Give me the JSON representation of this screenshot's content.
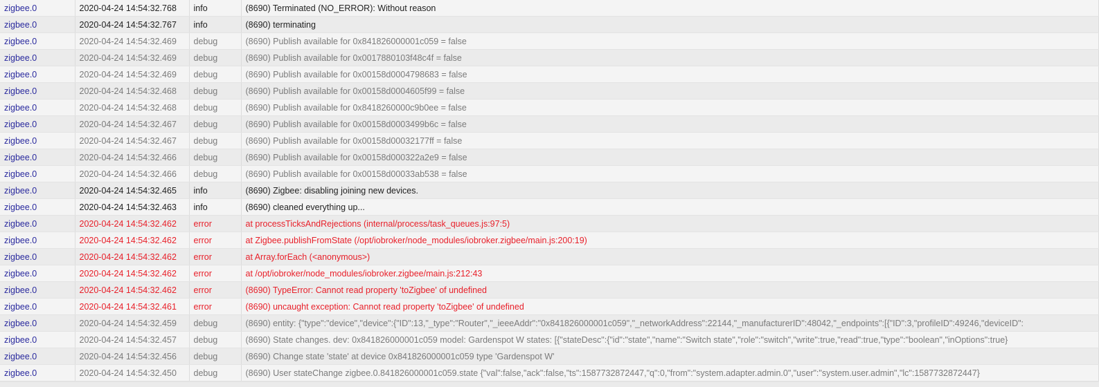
{
  "log": {
    "rows": [
      {
        "source": "zigbee.0",
        "time": "2020-04-24 14:54:32.768",
        "severity": "info",
        "message": "(8690) Terminated (NO_ERROR): Without reason"
      },
      {
        "source": "zigbee.0",
        "time": "2020-04-24 14:54:32.767",
        "severity": "info",
        "message": "(8690) terminating"
      },
      {
        "source": "zigbee.0",
        "time": "2020-04-24 14:54:32.469",
        "severity": "debug",
        "message": "(8690) Publish available for 0x841826000001c059 = false"
      },
      {
        "source": "zigbee.0",
        "time": "2020-04-24 14:54:32.469",
        "severity": "debug",
        "message": "(8690) Publish available for 0x0017880103f48c4f = false"
      },
      {
        "source": "zigbee.0",
        "time": "2020-04-24 14:54:32.469",
        "severity": "debug",
        "message": "(8690) Publish available for 0x00158d0004798683 = false"
      },
      {
        "source": "zigbee.0",
        "time": "2020-04-24 14:54:32.468",
        "severity": "debug",
        "message": "(8690) Publish available for 0x00158d0004605f99 = false"
      },
      {
        "source": "zigbee.0",
        "time": "2020-04-24 14:54:32.468",
        "severity": "debug",
        "message": "(8690) Publish available for 0x8418260000c9b0ee = false"
      },
      {
        "source": "zigbee.0",
        "time": "2020-04-24 14:54:32.467",
        "severity": "debug",
        "message": "(8690) Publish available for 0x00158d0003499b6c = false"
      },
      {
        "source": "zigbee.0",
        "time": "2020-04-24 14:54:32.467",
        "severity": "debug",
        "message": "(8690) Publish available for 0x00158d00032177ff = false"
      },
      {
        "source": "zigbee.0",
        "time": "2020-04-24 14:54:32.466",
        "severity": "debug",
        "message": "(8690) Publish available for 0x00158d000322a2e9 = false"
      },
      {
        "source": "zigbee.0",
        "time": "2020-04-24 14:54:32.466",
        "severity": "debug",
        "message": "(8690) Publish available for 0x00158d00033ab538 = false"
      },
      {
        "source": "zigbee.0",
        "time": "2020-04-24 14:54:32.465",
        "severity": "info",
        "message": "(8690) Zigbee: disabling joining new devices."
      },
      {
        "source": "zigbee.0",
        "time": "2020-04-24 14:54:32.463",
        "severity": "info",
        "message": "(8690) cleaned everything up..."
      },
      {
        "source": "zigbee.0",
        "time": "2020-04-24 14:54:32.462",
        "severity": "error",
        "message": "at processTicksAndRejections (internal/process/task_queues.js:97:5)"
      },
      {
        "source": "zigbee.0",
        "time": "2020-04-24 14:54:32.462",
        "severity": "error",
        "message": "at Zigbee.publishFromState (/opt/iobroker/node_modules/iobroker.zigbee/main.js:200:19)"
      },
      {
        "source": "zigbee.0",
        "time": "2020-04-24 14:54:32.462",
        "severity": "error",
        "message": "at Array.forEach (<anonymous>)"
      },
      {
        "source": "zigbee.0",
        "time": "2020-04-24 14:54:32.462",
        "severity": "error",
        "message": "at /opt/iobroker/node_modules/iobroker.zigbee/main.js:212:43"
      },
      {
        "source": "zigbee.0",
        "time": "2020-04-24 14:54:32.462",
        "severity": "error",
        "message": "(8690) TypeError: Cannot read property 'toZigbee' of undefined"
      },
      {
        "source": "zigbee.0",
        "time": "2020-04-24 14:54:32.461",
        "severity": "error",
        "message": "(8690) uncaught exception: Cannot read property 'toZigbee' of undefined"
      },
      {
        "source": "zigbee.0",
        "time": "2020-04-24 14:54:32.459",
        "severity": "debug",
        "message": "(8690) entity: {\"type\":\"device\",\"device\":{\"ID\":13,\"_type\":\"Router\",\"_ieeeAddr\":\"0x841826000001c059\",\"_networkAddress\":22144,\"_manufacturerID\":48042,\"_endpoints\":[{\"ID\":3,\"profileID\":49246,\"deviceID\":"
      },
      {
        "source": "zigbee.0",
        "time": "2020-04-24 14:54:32.457",
        "severity": "debug",
        "message": "(8690) State changes. dev: 0x841826000001c059 model: Gardenspot W states: [{\"stateDesc\":{\"id\":\"state\",\"name\":\"Switch state\",\"role\":\"switch\",\"write\":true,\"read\":true,\"type\":\"boolean\",\"inOptions\":true}"
      },
      {
        "source": "zigbee.0",
        "time": "2020-04-24 14:54:32.456",
        "severity": "debug",
        "message": "(8690) Change state 'state' at device 0x841826000001c059 type 'Gardenspot W'"
      },
      {
        "source": "zigbee.0",
        "time": "2020-04-24 14:54:32.450",
        "severity": "debug",
        "message": "(8690) User stateChange zigbee.0.841826000001c059.state {\"val\":false,\"ack\":false,\"ts\":1587732872447,\"q\":0,\"from\":\"system.adapter.admin.0\",\"user\":\"system.user.admin\",\"lc\":1587732872447}"
      }
    ]
  },
  "colors": {
    "source": "#2a2a9e",
    "info": "#222222",
    "debug": "#7b7b7b",
    "error": "#e8202a"
  }
}
